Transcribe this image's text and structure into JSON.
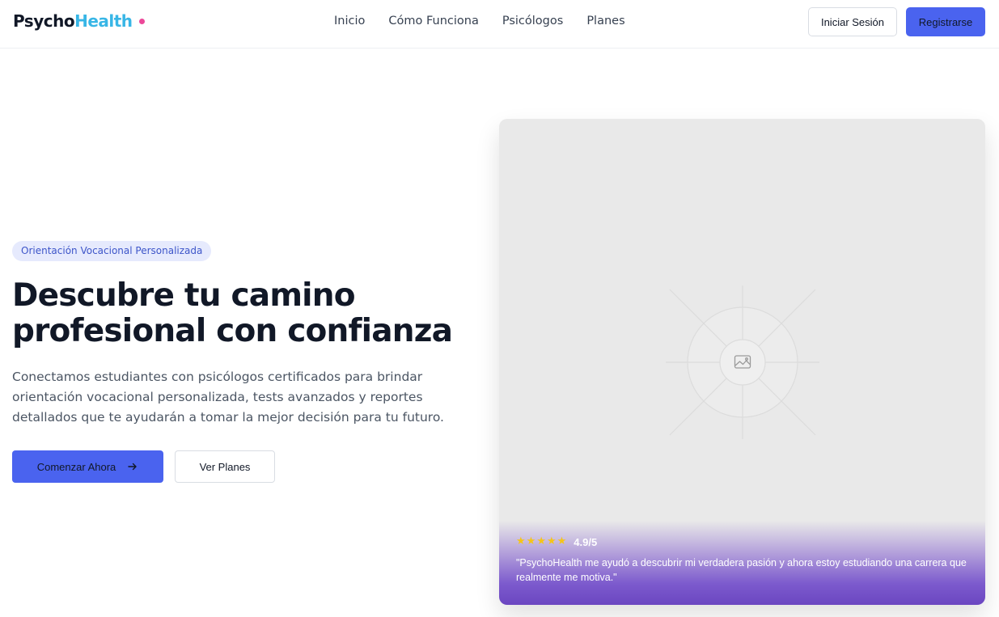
{
  "brand": {
    "part1": "Psycho",
    "part2": "Health",
    "accent_colors": {
      "part2": "#38b6e6",
      "dot": "#ec4899"
    }
  },
  "nav": {
    "links": [
      "Inicio",
      "Cómo Funciona",
      "Psicólogos",
      "Planes"
    ],
    "login_label": "Iniciar Sesión",
    "register_label": "Registrarse"
  },
  "hero": {
    "badge": "Orientación Vocacional Personalizada",
    "headline_line1": "Descubre tu camino",
    "headline_line2": "profesional con confianza",
    "subtitle": "Conectamos estudiantes con psicólogos certificados para brindar orientación vocacional personalizada, tests avanzados y reportes detallados que te ayudarán a tomar la mejor decisión para tu futuro.",
    "cta_primary": "Comenzar Ahora",
    "cta_primary_icon": "arrow-right-icon",
    "cta_secondary": "Ver Planes"
  },
  "image_card": {
    "placeholder_icon": "image-icon",
    "rating": {
      "stars": 5,
      "value": "4.9/5"
    },
    "quote": "\"PsychoHealth me ayudó a descubrir mi verdadera pasión y ahora estoy estudiando una carrera que realmente me motiva.\""
  },
  "colors": {
    "primary": "#4a63ef",
    "badge_bg": "#e6eafd",
    "star": "#f5c518",
    "testimonial_gradient_end": "#6b46c1"
  }
}
